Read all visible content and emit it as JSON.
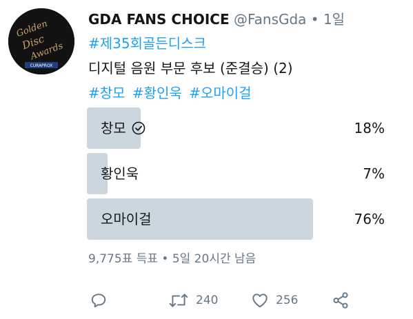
{
  "tweet": {
    "display_name": "GDA FANS CHOICE",
    "handle": "@FansGda",
    "separator": "•",
    "time": "1일",
    "hashtags_line1": "#제35회골든디스크",
    "text": "디지털 음원 부문 후보 (준결승) (2)",
    "hashtags_line2": [
      "#창모",
      "#황인욱",
      "#오마이걸"
    ],
    "avatar_icon": "golden-disc-awards-logo"
  },
  "poll": {
    "options": [
      {
        "label": "창모",
        "percent": "18%",
        "fraction": 0.18,
        "selected": true
      },
      {
        "label": "황인욱",
        "percent": "7%",
        "fraction": 0.07,
        "selected": false
      },
      {
        "label": "오마이걸",
        "percent": "76%",
        "fraction": 0.76,
        "selected": false
      }
    ],
    "meta": "9,775표 득표 • 5일 20시간 남음"
  },
  "actions": {
    "reply_icon": "reply-icon",
    "retweet_icon": "retweet-icon",
    "retweet_count": "240",
    "like_icon": "heart-icon",
    "like_count": "256",
    "share_icon": "share-icon"
  },
  "colors": {
    "link": "#1da1f2",
    "muted": "#657786",
    "poll_bar": "#ccd6dd"
  }
}
